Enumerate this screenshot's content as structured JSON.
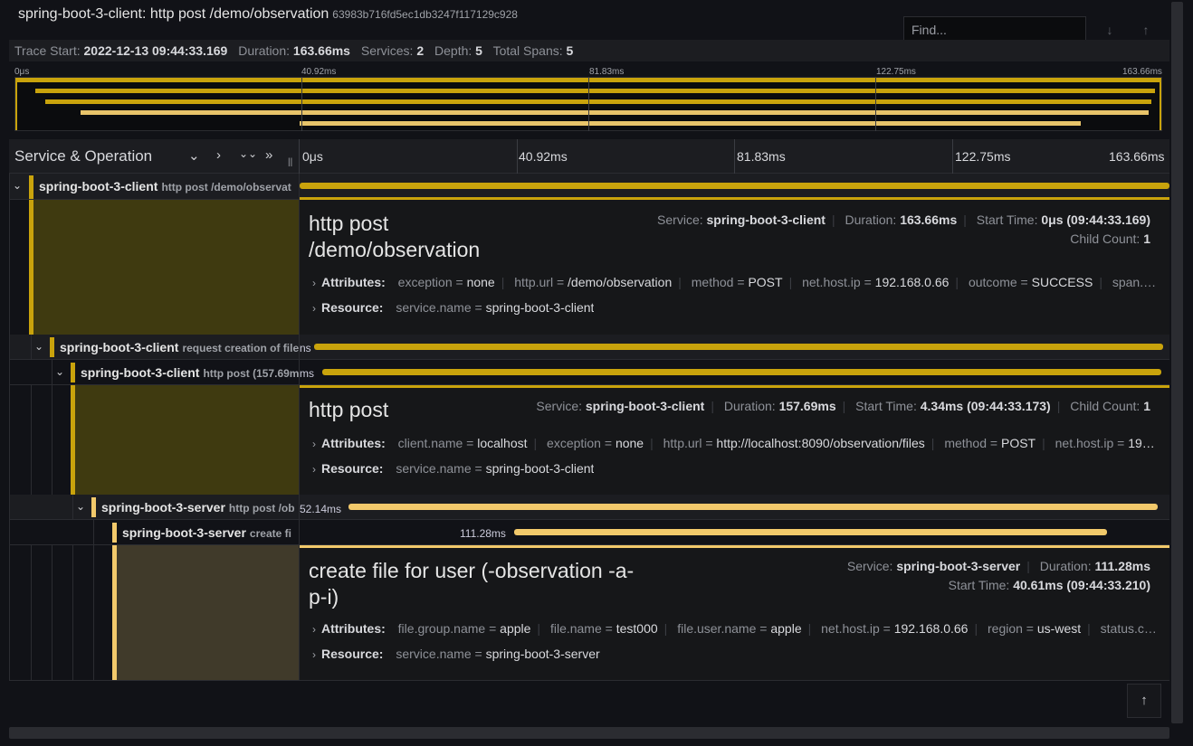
{
  "header": {
    "title": "spring-boot-3-client: http post /demo/observation",
    "trace_id": "63983b716fd5ec1db3247f117129c928",
    "find_placeholder": "Find...",
    "nav_down": "↓",
    "nav_up": "↑"
  },
  "meta": {
    "trace_start_label": "Trace Start:",
    "trace_start": "2022-12-13 09:44:33.169",
    "duration_label": "Duration:",
    "duration": "163.66ms",
    "services_label": "Services:",
    "services": "2",
    "depth_label": "Depth:",
    "depth": "5",
    "total_spans_label": "Total Spans:",
    "total_spans": "5"
  },
  "ticks": [
    "0μs",
    "40.92ms",
    "81.83ms",
    "122.75ms",
    "163.66ms"
  ],
  "table_header": {
    "title": "Service & Operation",
    "c1": "⌄",
    "c2": "›",
    "c3": "⌄⌄",
    "c4": "»",
    "resizer": "||"
  },
  "spans": [
    {
      "service": "spring-boot-3-client",
      "operation": "http post /demo/observat",
      "duration": ""
    },
    {
      "service": "spring-boot-3-client",
      "operation": "request creation of file",
      "duration": "ns"
    },
    {
      "service": "spring-boot-3-client",
      "operation": "http post (157.69ms",
      "duration": "ms"
    },
    {
      "service": "spring-boot-3-server",
      "operation": "http post /ob",
      "duration": "52.14ms"
    },
    {
      "service": "spring-boot-3-server",
      "operation": "create fi",
      "duration": "111.28ms"
    }
  ],
  "details": [
    {
      "title_line1": "http post",
      "title_line2": "/demo/observation",
      "service_label": "Service:",
      "service": "spring-boot-3-client",
      "duration_label": "Duration:",
      "duration": "163.66ms",
      "start_label": "Start Time:",
      "start": "0μs (09:44:33.169)",
      "child_label": "Child Count:",
      "child": "1",
      "attributes_label": "Attributes:",
      "attributes": [
        {
          "k": "exception",
          "v": "none"
        },
        {
          "k": "http.url",
          "v": "/demo/observation"
        },
        {
          "k": "method",
          "v": "POST"
        },
        {
          "k": "net.host.ip",
          "v": "192.168.0.66"
        },
        {
          "k": "outcome",
          "v": "SUCCESS"
        },
        {
          "k": "span.kin…",
          "v": ""
        }
      ],
      "resource_label": "Resource:",
      "resource": {
        "k": "service.name",
        "v": "spring-boot-3-client"
      }
    },
    {
      "title_line1": "http post",
      "title_line2": "",
      "service_label": "Service:",
      "service": "spring-boot-3-client",
      "duration_label": "Duration:",
      "duration": "157.69ms",
      "start_label": "Start Time:",
      "start": "4.34ms (09:44:33.173)",
      "child_label": "Child Count:",
      "child": "1",
      "attributes_label": "Attributes:",
      "attributes": [
        {
          "k": "client.name",
          "v": "localhost"
        },
        {
          "k": "exception",
          "v": "none"
        },
        {
          "k": "http.url",
          "v": "http://localhost:8090/observation/files"
        },
        {
          "k": "method",
          "v": "POST"
        },
        {
          "k": "net.host.ip",
          "v": "19…"
        }
      ],
      "resource_label": "Resource:",
      "resource": {
        "k": "service.name",
        "v": "spring-boot-3-client"
      }
    },
    {
      "title_line1": "create file for user (-observation -a-",
      "title_line2": "p-i)",
      "service_label": "Service:",
      "service": "spring-boot-3-server",
      "duration_label": "Duration:",
      "duration": "111.28ms",
      "start_label": "Start Time:",
      "start": "40.61ms (09:44:33.210)",
      "attributes_label": "Attributes:",
      "attributes": [
        {
          "k": "file.group.name",
          "v": "apple"
        },
        {
          "k": "file.name",
          "v": "test000"
        },
        {
          "k": "file.user.name",
          "v": "apple"
        },
        {
          "k": "net.host.ip",
          "v": "192.168.0.66"
        },
        {
          "k": "region",
          "v": "us-west"
        },
        {
          "k": "status.cod…",
          "v": ""
        }
      ],
      "resource_label": "Resource:",
      "resource": {
        "k": "service.name",
        "v": "spring-boot-3-server"
      }
    }
  ],
  "scroll_top": "↑",
  "colors": {
    "client": "#c9a30c",
    "server": "#f2c96b"
  }
}
